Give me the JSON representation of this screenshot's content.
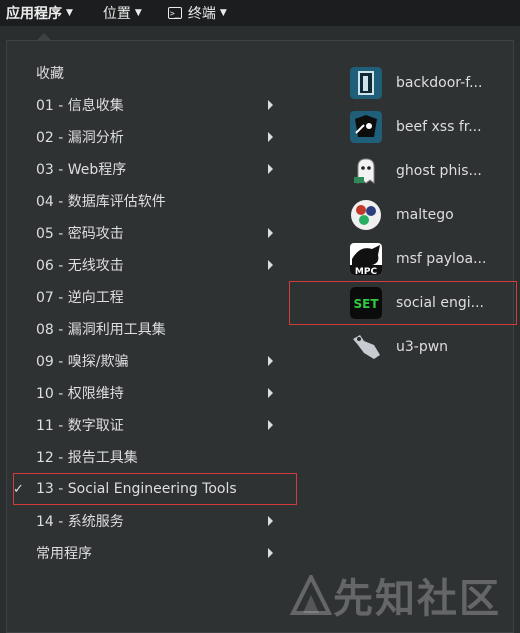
{
  "topbar": {
    "apps_label": "应用程序",
    "places_label": "位置",
    "terminal_label": "终端"
  },
  "categories": [
    {
      "label": "收藏",
      "submenu": false
    },
    {
      "label": "01 - 信息收集",
      "submenu": true
    },
    {
      "label": "02 - 漏洞分析",
      "submenu": true
    },
    {
      "label": "03 - Web程序",
      "submenu": true
    },
    {
      "label": "04 - 数据库评估软件",
      "submenu": false
    },
    {
      "label": "05 - 密码攻击",
      "submenu": true
    },
    {
      "label": "06 - 无线攻击",
      "submenu": true
    },
    {
      "label": "07 - 逆向工程",
      "submenu": false
    },
    {
      "label": "08 - 漏洞利用工具集",
      "submenu": false
    },
    {
      "label": "09 - 嗅探/欺骗",
      "submenu": true
    },
    {
      "label": "10 - 权限维持",
      "submenu": true
    },
    {
      "label": "11 - 数字取证",
      "submenu": true
    },
    {
      "label": "12 - 报告工具集",
      "submenu": false
    },
    {
      "label": "13 - Social Engineering Tools",
      "submenu": false,
      "selected": true,
      "check": "✓"
    },
    {
      "label": "14 - 系统服务",
      "submenu": true
    },
    {
      "label": "常用程序",
      "submenu": true
    }
  ],
  "apps": [
    {
      "label": "backdoor-f...",
      "icon": "backdoor-factory-icon",
      "bg": "#1f5f7a"
    },
    {
      "label": "beef xss fr...",
      "icon": "beef-icon",
      "bg": "#1f5f7a"
    },
    {
      "label": "ghost phis...",
      "icon": "ghost-phisher-icon",
      "bg": "#3a3d3e"
    },
    {
      "label": "maltego",
      "icon": "maltego-icon",
      "bg": "#eaeaea"
    },
    {
      "label": "msf payloa...",
      "icon": "msfpc-icon",
      "bg": "#ffffff",
      "icon_text": "MPC"
    },
    {
      "label": "social engi...",
      "icon": "set-icon",
      "bg": "#000000",
      "icon_text": "SET",
      "highlight": true
    },
    {
      "label": "u3-pwn",
      "icon": "u3-pwn-icon",
      "bg": "transparent"
    }
  ],
  "watermark": "先知社区",
  "colors": {
    "highlight_border": "#d23c3c",
    "set_green": "#2ecc40"
  }
}
